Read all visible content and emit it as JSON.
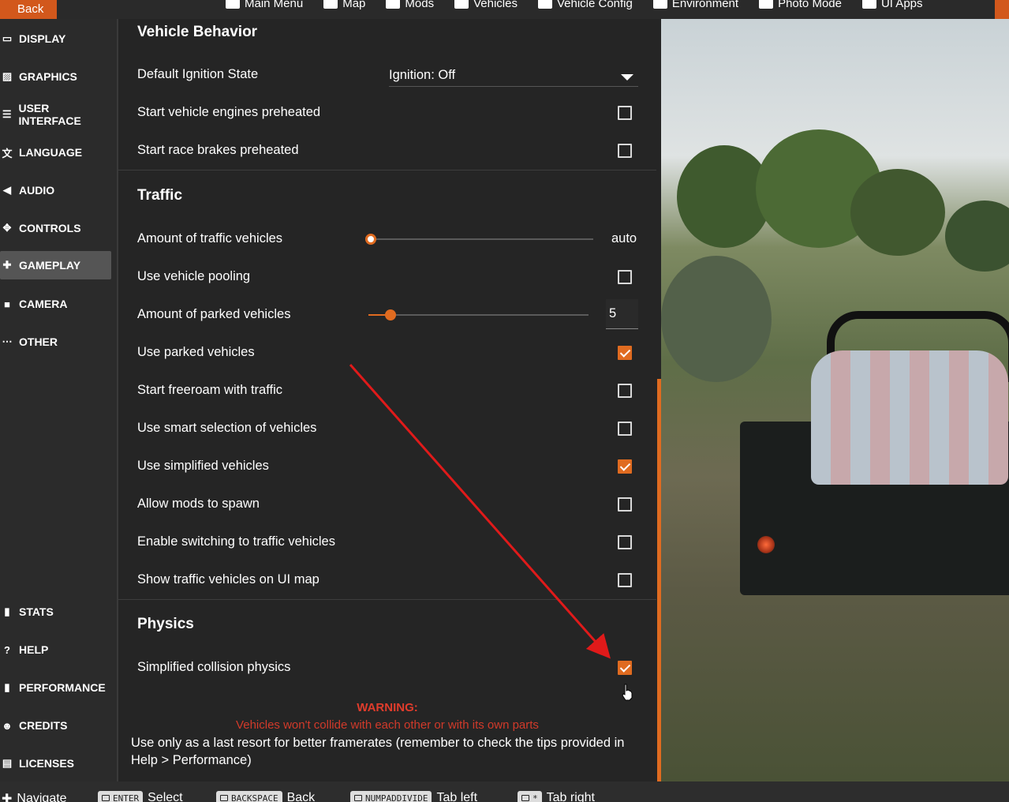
{
  "topbar": {
    "back_label": "Back",
    "items": [
      {
        "label": "Main Menu",
        "icon": "main-menu-icon"
      },
      {
        "label": "Map",
        "icon": "map-icon"
      },
      {
        "label": "Mods",
        "icon": "puzzle-icon"
      },
      {
        "label": "Vehicles",
        "icon": "car-icon"
      },
      {
        "label": "Vehicle Config",
        "icon": "vehicle-config-icon"
      },
      {
        "label": "Environment",
        "icon": "weather-icon"
      },
      {
        "label": "Photo Mode",
        "icon": "camera-icon"
      },
      {
        "label": "UI Apps",
        "icon": "ui-apps-icon"
      }
    ]
  },
  "sidebar": {
    "items": [
      {
        "label": "DISPLAY",
        "icon": "monitor-icon",
        "active": false
      },
      {
        "label": "GRAPHICS",
        "icon": "image-icon",
        "active": false
      },
      {
        "label": "USER INTERFACE",
        "icon": "ui-icon",
        "active": false
      },
      {
        "label": "LANGUAGE",
        "icon": "translate-icon",
        "active": false
      },
      {
        "label": "AUDIO",
        "icon": "speaker-icon",
        "active": false
      },
      {
        "label": "CONTROLS",
        "icon": "gamepad-icon",
        "active": false
      },
      {
        "label": "GAMEPLAY",
        "icon": "puzzle-icon",
        "active": true
      },
      {
        "label": "CAMERA",
        "icon": "video-camera-icon",
        "active": false
      },
      {
        "label": "OTHER",
        "icon": "more-icon",
        "active": false
      }
    ],
    "bottom_items": [
      {
        "label": "STATS",
        "icon": "bar-chart-icon"
      },
      {
        "label": "HELP",
        "icon": "help-icon"
      },
      {
        "label": "PERFORMANCE",
        "icon": "bar-chart-icon"
      },
      {
        "label": "CREDITS",
        "icon": "people-icon"
      },
      {
        "label": "LICENSES",
        "icon": "document-icon"
      }
    ]
  },
  "vehicle_behavior": {
    "title": "Vehicle Behavior",
    "ignition_label": "Default Ignition State",
    "ignition_value": "Ignition: Off",
    "engines_preheated_label": "Start vehicle engines preheated",
    "engines_preheated": false,
    "brakes_preheated_label": "Start race brakes preheated",
    "brakes_preheated": false
  },
  "traffic": {
    "title": "Traffic",
    "amount_label": "Amount of traffic vehicles",
    "amount_value": "auto",
    "amount_fraction": 0.0,
    "pooling_label": "Use vehicle pooling",
    "pooling": false,
    "parked_amount_label": "Amount of parked vehicles",
    "parked_amount_value": "5",
    "parked_amount_fraction": 0.1,
    "use_parked_label": "Use parked vehicles",
    "use_parked": true,
    "freeroam_label": "Start freeroam with traffic",
    "freeroam": false,
    "smart_selection_label": "Use smart selection of vehicles",
    "smart_selection": false,
    "simplified_label": "Use simplified vehicles",
    "simplified": true,
    "mods_spawn_label": "Allow mods to spawn",
    "mods_spawn": false,
    "switching_label": "Enable switching to traffic vehicles",
    "switching": false,
    "show_on_map_label": "Show traffic vehicles on UI map",
    "show_on_map": false
  },
  "physics": {
    "title": "Physics",
    "collision_label": "Simplified collision physics",
    "collision": true,
    "warning_title": "WARNING:",
    "warning_text": "Vehicles won't collide with each other or with its own parts",
    "info_text": "Use only as a last resort for better framerates (remember to check the tips provided in Help > Performance)"
  },
  "bottombar": {
    "hints": [
      {
        "key": "",
        "label": "Navigate"
      },
      {
        "key": "ENTER",
        "label": "Select"
      },
      {
        "key": "BACKSPACE",
        "label": "Back"
      },
      {
        "key": "NUMPADDIVIDE",
        "label": "Tab left"
      },
      {
        "key": "*",
        "label": "Tab right"
      }
    ]
  },
  "colors": {
    "accent": "#e06b20",
    "warning": "#e03c2c",
    "annotation_arrow": "#e01a1a"
  }
}
